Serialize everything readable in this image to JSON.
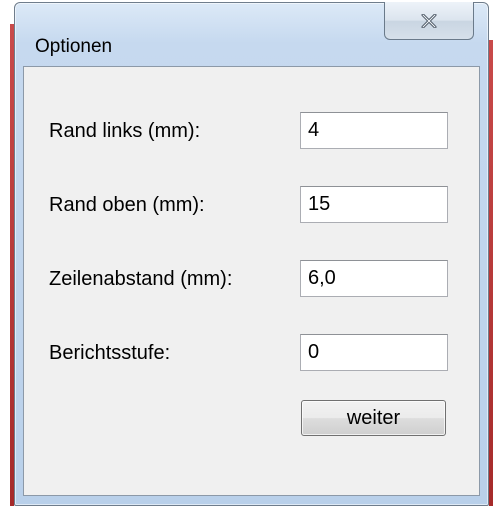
{
  "window": {
    "title": "Optionen",
    "close_symbol": "x"
  },
  "form": {
    "fields": [
      {
        "label": "Rand links (mm):",
        "value": "4"
      },
      {
        "label": "Rand oben (mm):",
        "value": "15"
      },
      {
        "label": "Zeilenabstand (mm):",
        "value": "6,0"
      },
      {
        "label": "Berichtsstufe:",
        "value": "0"
      }
    ],
    "submit_label": "weiter"
  },
  "colors": {
    "frame": "#c6d9ef",
    "client": "#f0f0f0",
    "accent": "#b03030"
  }
}
